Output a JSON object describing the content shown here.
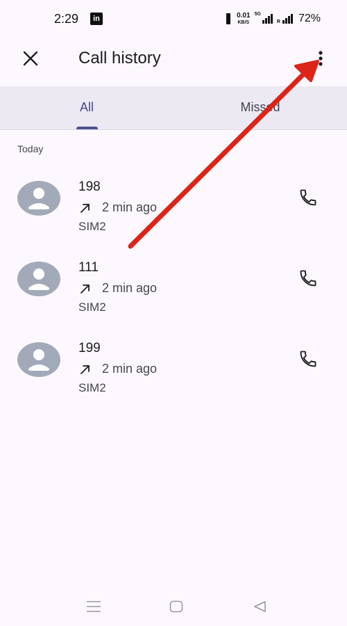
{
  "status_bar": {
    "time": "2:29",
    "app_icon": "linkedin-icon",
    "app_icon_letters": "in",
    "speed_value": "0.01",
    "speed_unit": "KB/S",
    "network_type": "5G",
    "roaming": "R",
    "battery": "72%"
  },
  "app_bar": {
    "title": "Call history",
    "close_icon": "close-icon",
    "more_icon": "more-vert-icon"
  },
  "tabs": [
    {
      "label": "All",
      "selected": true
    },
    {
      "label": "Missed",
      "selected": false
    }
  ],
  "section": {
    "header": "Today"
  },
  "calls": [
    {
      "number": "198",
      "direction_icon": "outgoing-call-arrow-icon",
      "time": "2 min ago",
      "sim": "SIM2",
      "action_icon": "phone-icon"
    },
    {
      "number": "111",
      "direction_icon": "outgoing-call-arrow-icon",
      "time": "2 min ago",
      "sim": "SIM2",
      "action_icon": "phone-icon"
    },
    {
      "number": "199",
      "direction_icon": "outgoing-call-arrow-icon",
      "time": "2 min ago",
      "sim": "SIM2",
      "action_icon": "phone-icon"
    }
  ],
  "nav_bar": {
    "recents_icon": "menu-lines-icon",
    "home_icon": "home-square-icon",
    "back_icon": "back-triangle-icon"
  },
  "colors": {
    "background": "#fdf8fd",
    "tab_bar": "#ece9f3",
    "tab_selected": "#3f4a88",
    "avatar": "#a2aab9",
    "annotation_arrow": "#dc2418"
  }
}
